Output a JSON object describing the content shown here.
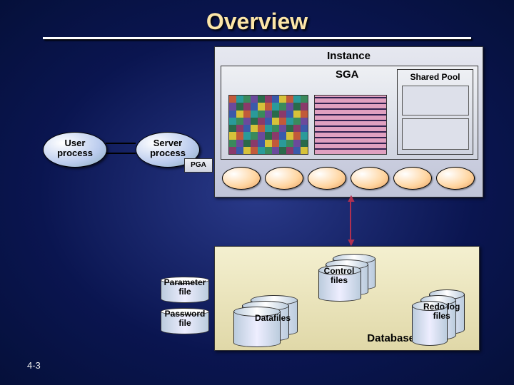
{
  "title": "Overview",
  "page_number": "4-3",
  "instance": {
    "label": "Instance",
    "sga_label": "SGA",
    "shared_pool_label": "Shared Pool"
  },
  "user_process": "User\nprocess",
  "server_process": "Server\nprocess",
  "pga_label": "PGA",
  "database": {
    "label": "Database",
    "control_files": "Control\nfiles",
    "datafiles": "Datafiles",
    "redo_log_files": "Redo log\nfiles"
  },
  "parameter_file": "Parameter\nfile",
  "password_file": "Password\nfile"
}
